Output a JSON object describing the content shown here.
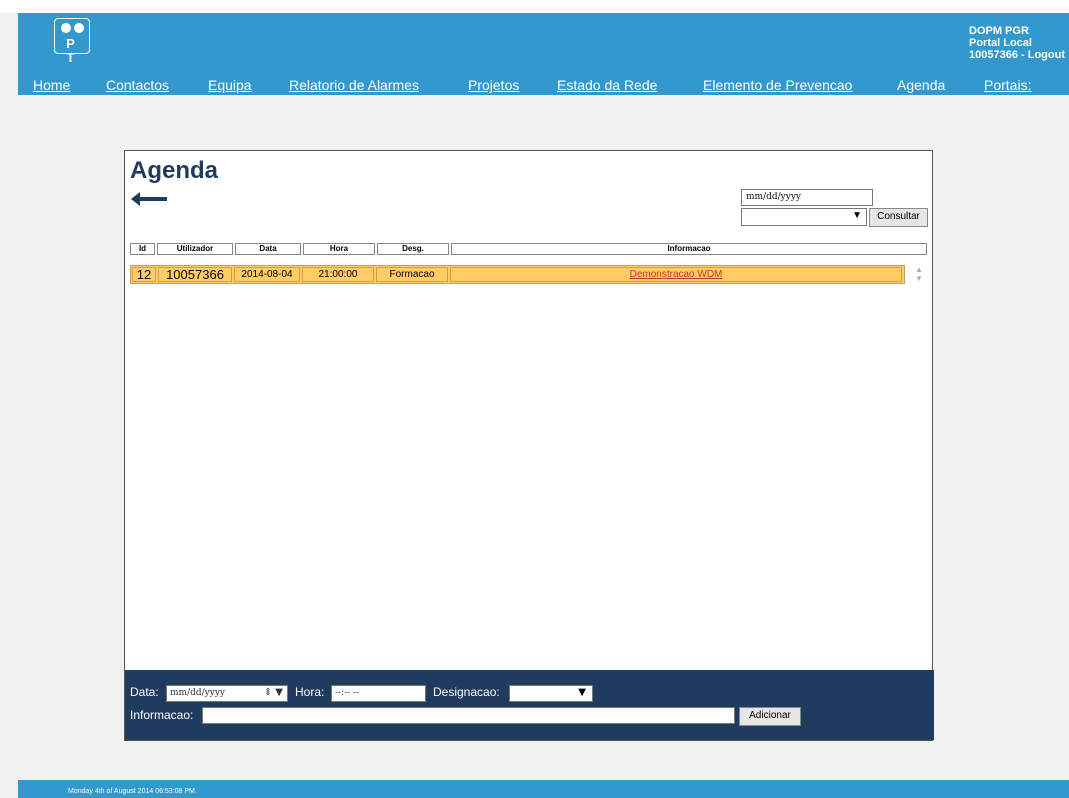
{
  "logo": {
    "letters": "P T"
  },
  "user": {
    "line1": "DOPM PGR",
    "line2": "Portal Local",
    "id": "10057366",
    "logout": "Logout"
  },
  "nav": [
    "Home",
    "Contactos",
    "Equipa",
    "Relatorio de Alarmes",
    "Projetos",
    "Estado da Rede",
    "Elemento de Prevencao",
    "Agenda",
    "Portais:"
  ],
  "page": {
    "title": "Agenda"
  },
  "query": {
    "date_placeholder": "mm/dd/yyyy",
    "select_value": "",
    "button": "Consultar"
  },
  "table": {
    "headers": [
      "Id",
      "Utilizador",
      "Data",
      "Hora",
      "Desg.",
      "Informacao"
    ],
    "rows": [
      {
        "id": "12",
        "user": "10057366",
        "date": "2014-08-04",
        "time": "21:00:00",
        "desg": "Formacao",
        "info": "Demonstracao WDM"
      }
    ]
  },
  "form": {
    "data_label": "Data:",
    "data_placeholder": "mm/dd/yyyy",
    "hora_label": "Hora:",
    "hora_placeholder": "--:-- --",
    "designacao_label": "Designacao:",
    "informacao_label": "Informacao:",
    "add_button": "Adicionar"
  },
  "footer": {
    "timestamp": "Monday 4th of August 2014 06:53:08 PM."
  },
  "colors": {
    "header": "#3399cc",
    "navy": "#1f3b5e",
    "row": "#ffcc66",
    "link": "#c0392b"
  }
}
